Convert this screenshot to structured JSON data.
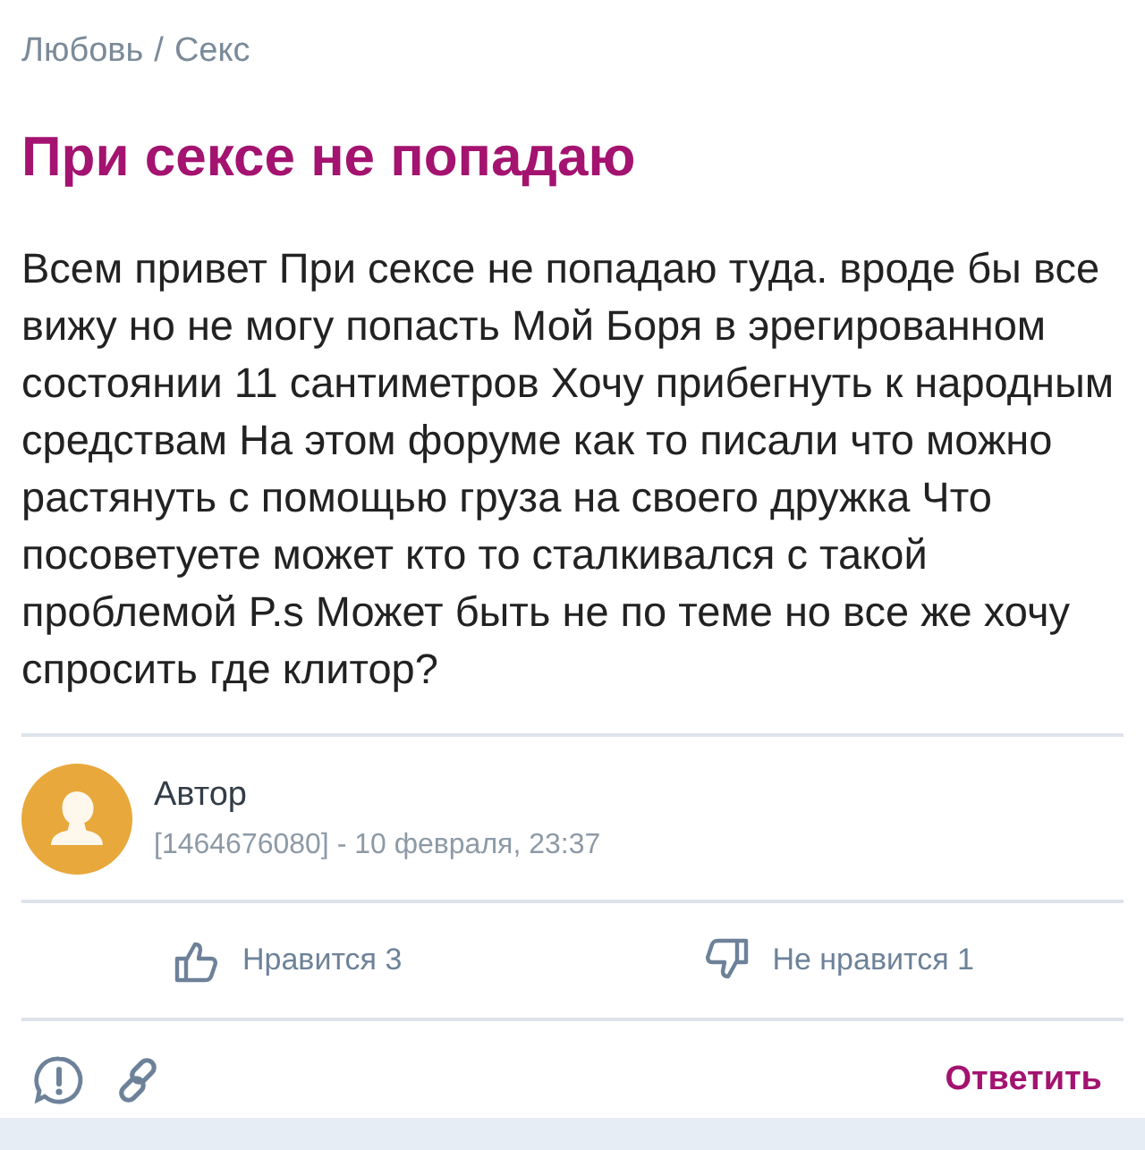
{
  "breadcrumb": {
    "category": "Любовь",
    "separator": "/",
    "subcategory": "Секс"
  },
  "title": "При сексе не попадаю",
  "body": "Всем привет При сексе не попадаю туда. вроде бы все вижу но не могу попасть Мой Боря в эрегированном состоянии 11 сантиметров Хочу прибегнуть к народным средствам На этом форуме как то писали что можно растянуть с помощью груза на своего дружка Что посоветуете может кто то сталкивался с такой проблемой P.s Может быть не по теме но все же хочу спросить где клитор?",
  "author": {
    "name": "Автор",
    "meta": "[1464676080] - 10 февраля, 23:37"
  },
  "reactions": {
    "like": "Нравится 3",
    "dislike": "Не нравится 1"
  },
  "reply_button": "Ответить"
}
